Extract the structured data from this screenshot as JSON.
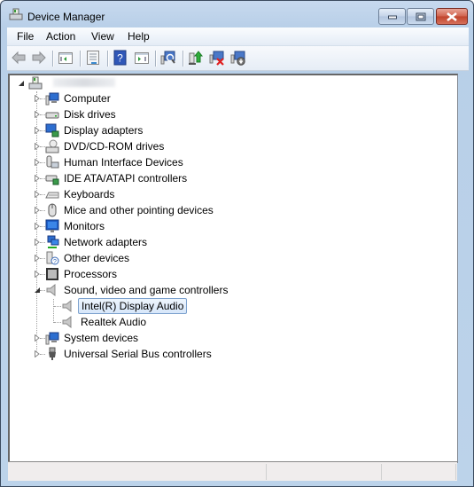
{
  "window": {
    "title": "Device Manager",
    "controls": {
      "minimize": "minimize",
      "maximize": "maximize",
      "close": "close"
    }
  },
  "menubar": {
    "items": [
      {
        "label": "File"
      },
      {
        "label": "Action"
      },
      {
        "label": "View"
      },
      {
        "label": "Help"
      }
    ]
  },
  "toolbar": {
    "buttons": [
      {
        "icon": "back-arrow-icon",
        "tooltip": "Back"
      },
      {
        "icon": "forward-arrow-icon",
        "tooltip": "Forward"
      },
      {
        "icon": "show-hide-console-tree-icon",
        "tooltip": "Show/Hide Console Tree"
      },
      {
        "icon": "properties-icon",
        "tooltip": "Properties"
      },
      {
        "icon": "help-icon",
        "tooltip": "Help"
      },
      {
        "icon": "show-hide-action-pane-icon",
        "tooltip": "Show/Hide Action Pane"
      },
      {
        "icon": "scan-hardware-icon",
        "tooltip": "Scan for hardware changes"
      },
      {
        "icon": "update-driver-icon",
        "tooltip": "Update Driver Software"
      },
      {
        "icon": "uninstall-icon",
        "tooltip": "Uninstall"
      },
      {
        "icon": "disable-icon",
        "tooltip": "Disable"
      }
    ]
  },
  "tree": {
    "root": {
      "label": "(computer name hidden)",
      "expanded": true
    },
    "categories": [
      {
        "label": "Computer",
        "icon": "computer-icon",
        "expanded": false
      },
      {
        "label": "Disk drives",
        "icon": "disk-drive-icon",
        "expanded": false
      },
      {
        "label": "Display adapters",
        "icon": "display-adapter-icon",
        "expanded": false
      },
      {
        "label": "DVD/CD-ROM drives",
        "icon": "dvd-drive-icon",
        "expanded": false
      },
      {
        "label": "Human Interface Devices",
        "icon": "hid-icon",
        "expanded": false
      },
      {
        "label": "IDE ATA/ATAPI controllers",
        "icon": "ide-controller-icon",
        "expanded": false
      },
      {
        "label": "Keyboards",
        "icon": "keyboard-icon",
        "expanded": false
      },
      {
        "label": "Mice and other pointing devices",
        "icon": "mouse-icon",
        "expanded": false
      },
      {
        "label": "Monitors",
        "icon": "monitor-icon",
        "expanded": false
      },
      {
        "label": "Network adapters",
        "icon": "network-adapter-icon",
        "expanded": false
      },
      {
        "label": "Other devices",
        "icon": "other-devices-icon",
        "expanded": false
      },
      {
        "label": "Processors",
        "icon": "processor-icon",
        "expanded": false
      },
      {
        "label": "Sound, video and game controllers",
        "icon": "speaker-icon",
        "expanded": true,
        "children": [
          {
            "label": "Intel(R) Display Audio",
            "icon": "speaker-icon",
            "selected": true
          },
          {
            "label": "Realtek Audio",
            "icon": "speaker-icon",
            "selected": false
          }
        ]
      },
      {
        "label": "System devices",
        "icon": "system-devices-icon",
        "expanded": false
      },
      {
        "label": "Universal Serial Bus controllers",
        "icon": "usb-icon",
        "expanded": false
      }
    ]
  },
  "statusbar": {
    "panes": [
      "",
      "",
      ""
    ]
  }
}
